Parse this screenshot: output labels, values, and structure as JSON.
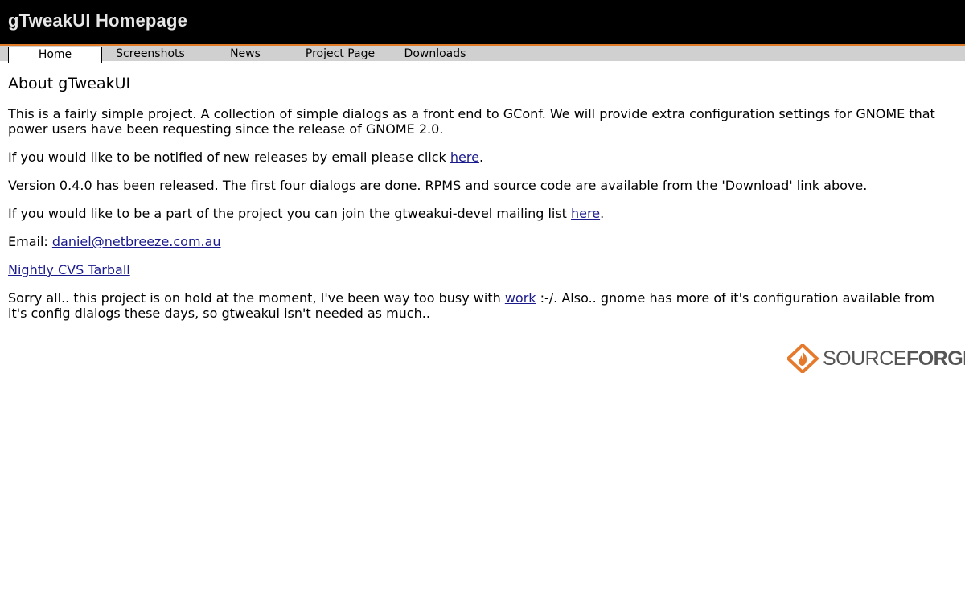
{
  "header": {
    "title": "gTweakUI Homepage"
  },
  "tabs": [
    {
      "label": "Home",
      "active": true
    },
    {
      "label": "Screenshots",
      "active": false
    },
    {
      "label": "News",
      "active": false
    },
    {
      "label": "Project Page",
      "active": false
    },
    {
      "label": "Downloads",
      "active": false
    }
  ],
  "content": {
    "heading": "About gTweakUI",
    "intro": "This is a fairly simple project. A collection of simple dialogs as a front end to GConf. We will provide extra configuration settings for GNOME that power users have been requesting since the release of GNOME 2.0.",
    "notify": {
      "text_before": "If you would like to be notified of new releases by email please click ",
      "link": "here",
      "text_after": "."
    },
    "version": "Version 0.4.0 has been released. The first four dialogs are done. RPMS and source code are available from the 'Download' link above.",
    "join": {
      "text_before": "If you would like to be a part of the project you can join the gtweakui-devel mailing list ",
      "link": "here",
      "text_after": "."
    },
    "email": {
      "label": "Email: ",
      "address": "daniel@netbreeze.com.au"
    },
    "tarball_link": "Nightly CVS Tarball",
    "hold": {
      "text_before": "Sorry all.. this project is on hold at the moment, I've been way too busy with ",
      "link": "work",
      "text_after": " :-/. Also.. gnome has more of it's configuration available from it's config dialogs these days, so gtweakui isn't needed as much.."
    }
  },
  "sourceforge_logo": {
    "text_light": "SOURCE",
    "text_bold": "FORGE",
    "icon": "sourceforge-diamond-icon",
    "accent_color": "#e57a2d"
  },
  "colors": {
    "header_bg": "#000000",
    "header_border": "#e07b2a",
    "tabbar_bg": "#d0d0d0",
    "link": "#1a1a8c"
  }
}
